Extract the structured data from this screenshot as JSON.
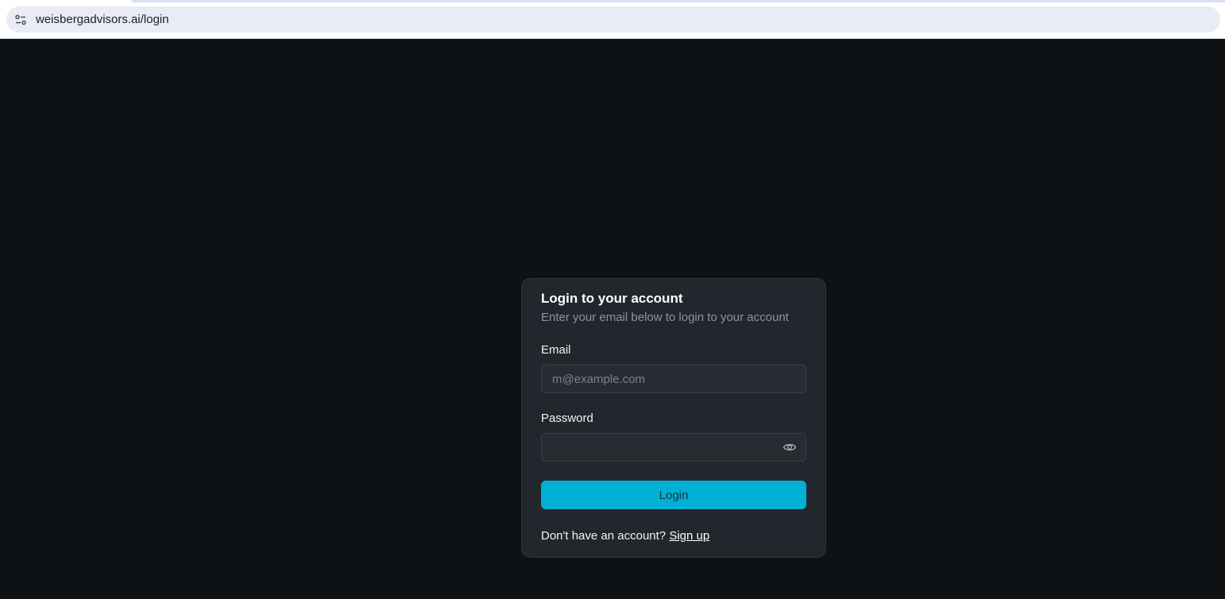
{
  "browser": {
    "url": "weisbergadvisors.ai/login",
    "site_info_icon": "site-info-tune-icon"
  },
  "login_card": {
    "title": "Login to your account",
    "subtitle": "Enter your email below to login to your account",
    "email": {
      "label": "Email",
      "placeholder": "m@example.com",
      "value": ""
    },
    "password": {
      "label": "Password",
      "placeholder": "",
      "value": "",
      "toggle_icon": "eye-icon"
    },
    "login_button": {
      "label": "Login",
      "color": "#00b0d6"
    },
    "signup": {
      "prompt": "Don't have an account?",
      "link_label": "Sign up"
    }
  },
  "colors": {
    "page_background": "#0f1215",
    "card_background": "#22272d",
    "accent": "#00b0d6"
  }
}
